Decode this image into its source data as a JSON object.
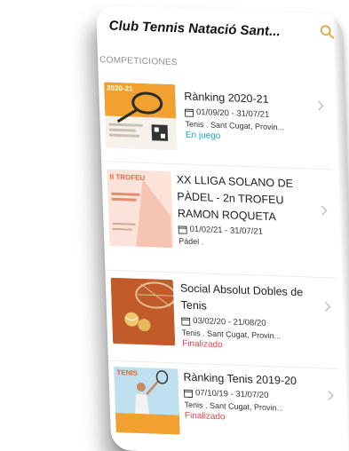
{
  "header": {
    "title": "Club Tennis Natació Sant...",
    "search_icon": "search-icon"
  },
  "section": {
    "label": "COMPETICIONES"
  },
  "competitions": [
    {
      "name": "Rànking 2020-21",
      "dates": "01/09/20 - 31/07/21",
      "location": "Tenis . Sant Cugat, Provin...",
      "status": "En juego",
      "status_color": "#1aa3c8",
      "thumb_caption": "2020-21"
    },
    {
      "name": "XX LLIGA SOLANO DE PÀDEL - 2n TROFEU RAMON ROQUETA",
      "dates": "01/02/21 - 31/07/21",
      "location": "Pádel .",
      "status": "",
      "status_color": "#1aa3c8",
      "thumb_caption": "II TROFEU"
    },
    {
      "name": "Social Absolut Dobles de Tenis",
      "dates": "03/02/20 - 21/08/20",
      "location": "Tenis . Sant Cugat, Provin...",
      "status": "Finalizado",
      "status_color": "#e0474c",
      "thumb_caption": ""
    },
    {
      "name": "Rànking Tenis 2019-20",
      "dates": "07/10/19 - 31/07/20",
      "location": "Tenis . Sant Cugat, Provin...",
      "status": "Finalizado",
      "status_color": "#e0474c",
      "thumb_caption": "TENIS"
    }
  ],
  "colors": {
    "accent": "#e8a33a",
    "in_play": "#1aa3c8",
    "finished": "#e0474c"
  }
}
